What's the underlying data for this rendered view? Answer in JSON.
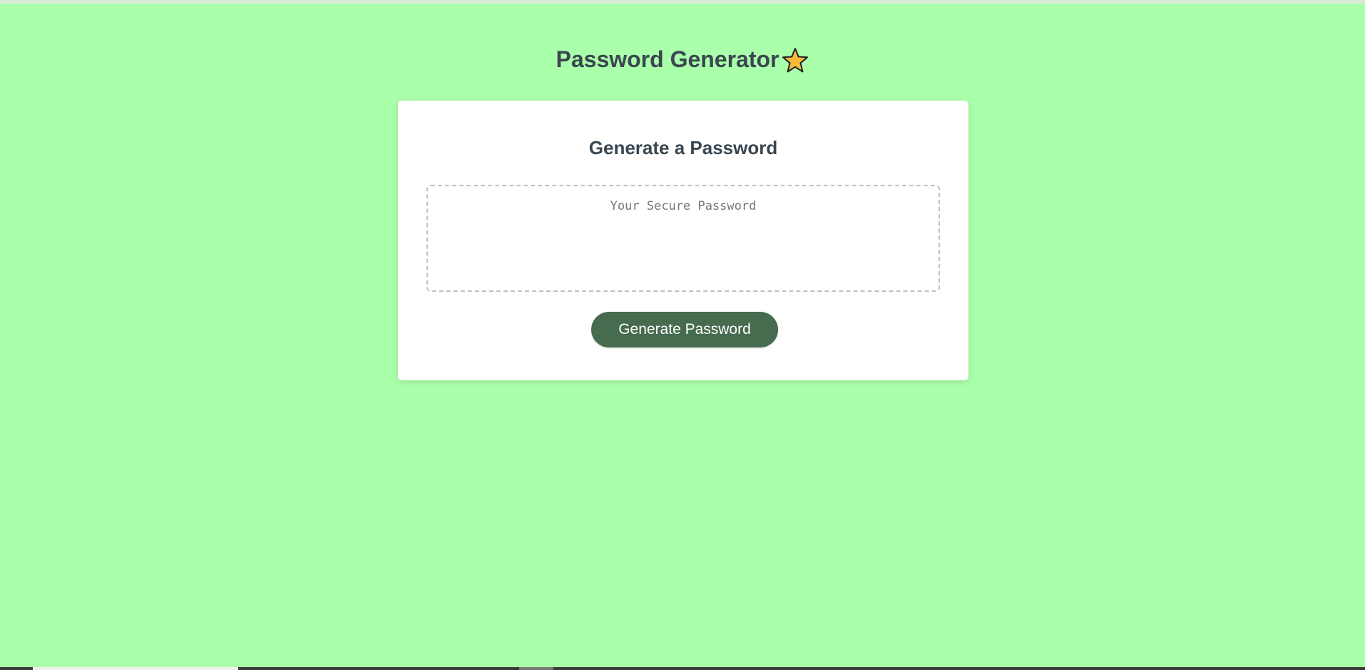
{
  "page": {
    "title": "Password Generator",
    "title_icon": "star-icon",
    "background_color": "#aaffaa"
  },
  "card": {
    "heading": "Generate a Password",
    "password_value": "",
    "password_placeholder": "Your Secure Password",
    "generate_button_label": "Generate Password",
    "button_color": "#466b4f"
  }
}
